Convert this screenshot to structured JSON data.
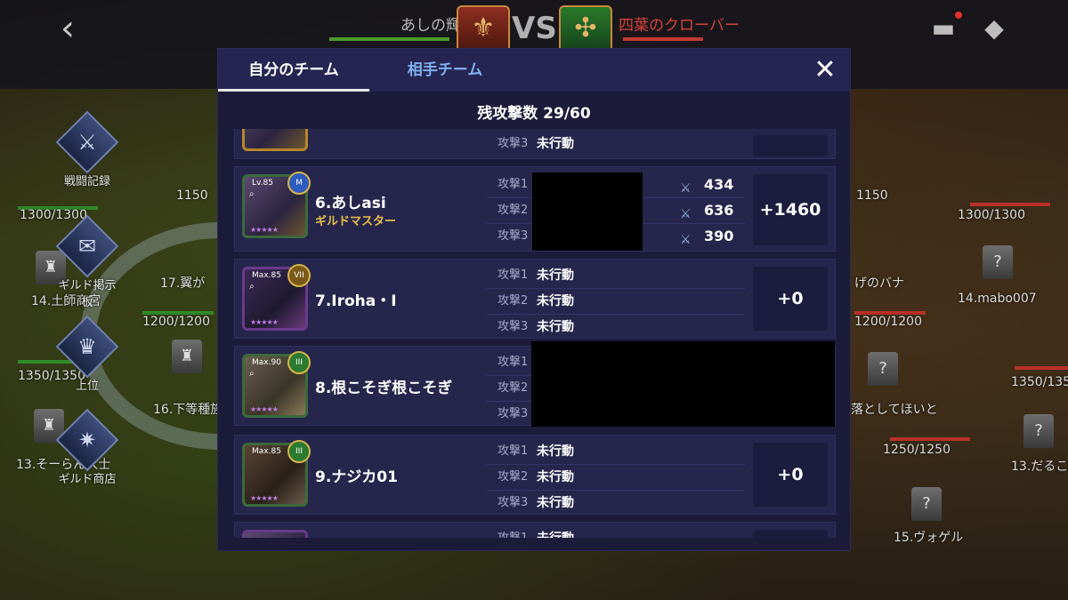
{
  "header": {
    "back_icon": "chevron-left-icon",
    "guild_left": "あしの輝き",
    "vs": "VS",
    "guild_right": "四葉のクローバー",
    "colors": {
      "left": "#b9b9b9",
      "right": "#d8423a"
    }
  },
  "side_menu": [
    {
      "label": "戦闘記録",
      "icon": "crossed-swords-icon"
    },
    {
      "label": "ギルド掲示板",
      "icon": "chat-icon"
    },
    {
      "label": "上位",
      "icon": "trophy-icon"
    },
    {
      "label": "ギルド商店",
      "icon": "shop-icon"
    }
  ],
  "map_labels": {
    "l1": "1150",
    "l2": "1300/1300",
    "l3": "14.土師商宮",
    "l4": "17.翼が",
    "l5": "1200/1200",
    "l6": "1350/1350",
    "l7": "16.下等種族",
    "l8": "13.そーらん人士",
    "r1": "1150",
    "r2": "1300/1300",
    "r3": "げのバナ",
    "r4": "14.mabo007",
    "r5": "1200/1200",
    "r6": "1350/1350",
    "r7": "落としてほいと",
    "r8": "1250/1250",
    "r9": "13.だるこ",
    "r10": "15.ヴォゲル"
  },
  "modal": {
    "tab_self": "自分のチーム",
    "tab_opponent": "相手チーム",
    "close_icon": "close-icon",
    "remaining_label": "残攻撃数 29/60",
    "top_partial": {
      "label": "攻撃3",
      "status": "未行動"
    },
    "players": [
      {
        "name": "6.あしasi",
        "role": "ギルドマスター",
        "level": "Lv.85",
        "badge": "M",
        "attacks": [
          {
            "label": "攻撃1",
            "status": "",
            "points": "434"
          },
          {
            "label": "攻撃2",
            "status": "",
            "points": "636"
          },
          {
            "label": "攻撃3",
            "status": "",
            "points": "390"
          }
        ],
        "total": "+1460"
      },
      {
        "name": "7.Iroha・I",
        "role": "",
        "level": "Max.85",
        "badge": "VII",
        "attacks": [
          {
            "label": "攻撃1",
            "status": "未行動"
          },
          {
            "label": "攻撃2",
            "status": "未行動"
          },
          {
            "label": "攻撃3",
            "status": "未行動"
          }
        ],
        "total": "+0"
      },
      {
        "name": "8.根こそぎ根こそぎ",
        "role": "",
        "level": "Max.90",
        "badge": "III",
        "attacks": [
          {
            "label": "攻撃1",
            "status": ""
          },
          {
            "label": "攻撃2",
            "status": ""
          },
          {
            "label": "攻撃3",
            "status": ""
          }
        ],
        "total": ""
      },
      {
        "name": "9.ナジカ01",
        "role": "",
        "level": "Max.85",
        "badge": "III",
        "attacks": [
          {
            "label": "攻撃1",
            "status": "未行動"
          },
          {
            "label": "攻撃2",
            "status": "未行動"
          },
          {
            "label": "攻撃3",
            "status": "未行動"
          }
        ],
        "total": "+0"
      }
    ],
    "bottom_partial": {
      "label": "攻撃1",
      "status": "未行動"
    }
  }
}
